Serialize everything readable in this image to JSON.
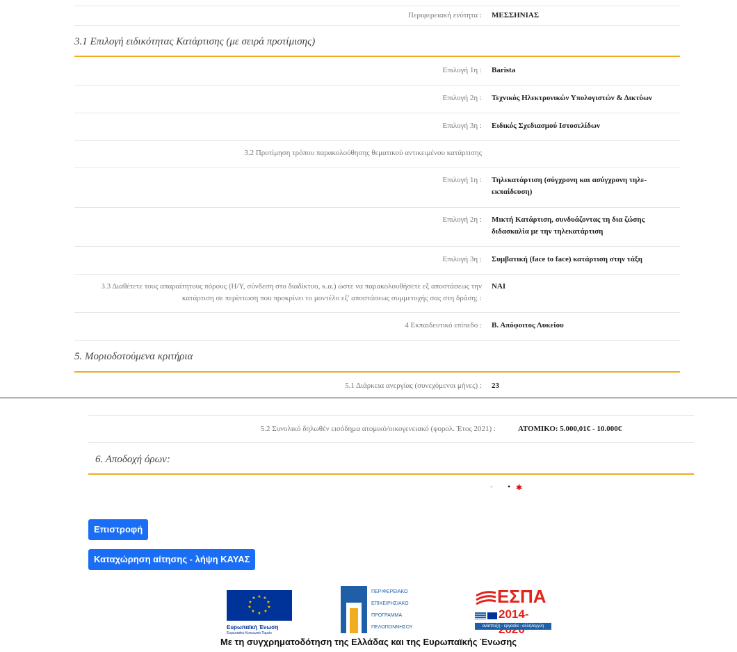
{
  "region": {
    "label": "Περιφερειακή ενότητα :",
    "value": "ΜΕΣΣΗΝΙΑΣ"
  },
  "section31": {
    "title": "3.1 Επιλογή ειδικότητας Κατάρτισης (με σειρά προτίμισης)",
    "choices": [
      {
        "label": "Επιλογή 1η :",
        "value": "Barista"
      },
      {
        "label": "Επιλογή 2η :",
        "value": "Τεχνικός Ηλεκτρονικών Υπολογιστών & Δικτύων"
      },
      {
        "label": "Επιλογή 3η :",
        "value": "Ειδικός Σχεδιασμού Ιστοσελίδων"
      }
    ]
  },
  "section32": {
    "title": "3.2 Προτίμηση τρόπου παρακολούθησης θεματικού αντικειμένου κατάρτισης",
    "choices": [
      {
        "label": "Επιλογή 1η :",
        "value": "Τηλεκατάρτιση (σύγχρονη και ασύγχρονη τηλε-εκπαίδευση)"
      },
      {
        "label": "Επιλογή 2η :",
        "value": "Μικτή Κατάρτιση, συνδυάζοντας τη δια ζώσης διδασκαλία με την τηλεκατάρτιση"
      },
      {
        "label": "Επιλογή 3η :",
        "value": "Συμβατική (face to face) κατάρτιση στην τάξη"
      }
    ]
  },
  "section33": {
    "label_line1": "3.3 Διαθέτετε τους απαραίτητους πόρους (Η/Υ, σύνδεση στο διαδίκτυο, κ.α.) ώστε να παρακολουθήσετε εξ αποστάσεως την",
    "label_line2": "κατάρτιση σε περίπτωση που προκρίνει το μοντέλο εξ' αποστάσεως συμμετοχής σας στη δράση; :",
    "value": "ΝΑΙ"
  },
  "education": {
    "label": "4 Εκπαιδευτικό επίπεδο :",
    "value": "Β. Απόφοιτος Λυκείου"
  },
  "section5": {
    "title": "5. Μοριοδοτούμενα κριτήρια",
    "unemployment": {
      "label": "5.1 Διάρκεια ανεργίας (συνεχόμενοι μήνες) :",
      "value": "23"
    },
    "income": {
      "label": "5.2 Συνολικό δηλωθέν εισόδημα ατομικό/οικογενειακό (φορολ. Έτος 2021) :",
      "value": "ΑΤΟΜΙΚΟ: 5.000,01€ - 10.000€"
    }
  },
  "section6": {
    "title": "6. Αποδοχή όρων:",
    "dash": "-",
    "bullet": "•",
    "required_mark": "✱"
  },
  "buttons": {
    "back": "Επιστροφή",
    "submit": "Καταχώρηση αίτησης - λήψη ΚΑΥΑΣ"
  },
  "logos": {
    "eu_line1": "Ευρωπαϊκή Ένωση",
    "eu_line2": "Ευρωπαϊκό Κοινωνικό Ταμείο",
    "pep_lines": [
      "ΠΕΡΙΦΕΡΕΙΑΚΟ",
      "ΕΠΙΧΕΙΡΗΣΙΑΚΟ",
      "ΠΡΟΓΡΑΜΜΑ",
      "ΠΕΛΟΠΟΝΝΗΣΟΥ"
    ],
    "espa_title": "ΕΣΠΑ",
    "espa_years": "2014-2020",
    "espa_slogan": "ανάπτυξη - εργασία - αλληλεγγύη",
    "funding": "Με τη συγχρηματοδότηση της Ελλάδας και της Ευρωπαϊκής Ένωσης"
  },
  "colors": {
    "accent": "#f0ad1e",
    "button": "#1a6ef5",
    "required": "#e00000",
    "eu_blue": "#003399",
    "eu_yellow": "#ffcc00",
    "pep_blue": "#1f5fa8",
    "espa_red": "#e2231a"
  }
}
